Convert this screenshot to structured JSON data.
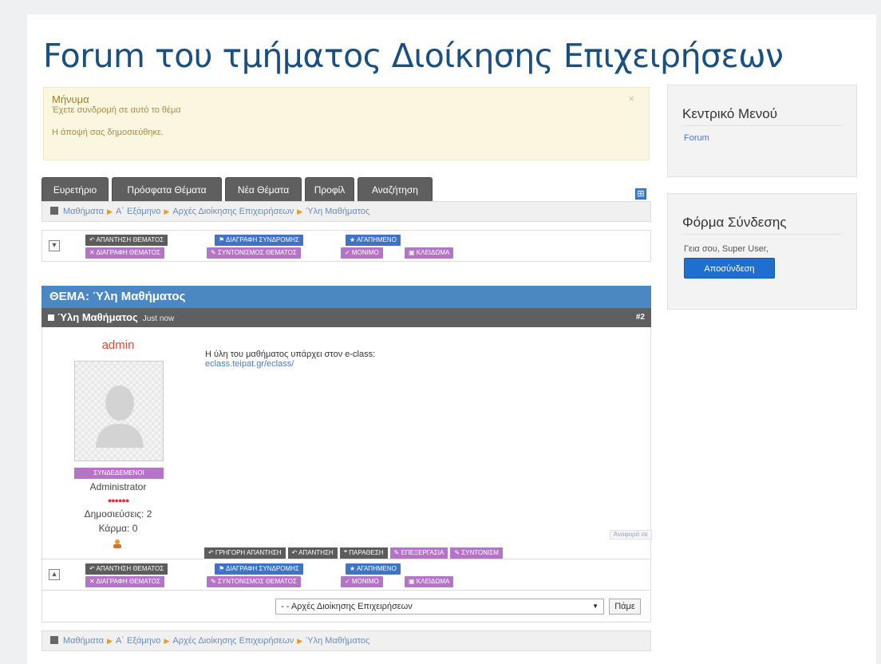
{
  "site": {
    "title": "Forum του τμήματος Διοίκησης Επιχειρήσεων"
  },
  "alert": {
    "heading": "Μήνυμα",
    "line1": "Έχετε συνδρομή σε αυτό το θέμα",
    "line2": "Η άποψή σας δημοσιεύθηκε.",
    "close": "×"
  },
  "tabs": [
    "Ευρετήριο",
    "Πρόσφατα Θέματα",
    "Νέα Θέματα",
    "Προφίλ",
    "Αναζήτηση"
  ],
  "breadcrumb": [
    "Μαθήματα",
    "Α΄ Εξάμηνο",
    "Αρχές Διοίκησης Επιχειρήσεων",
    "Ύλη Μαθήματος"
  ],
  "topic_actions": {
    "reply": "↶ ΑΠΑΝΤΗΣΗ ΘΕΜΑΤΟΣ",
    "unsubscribe": "⚑ ΔΙΑΓΡΑΦΗ ΣΥΝΔΡΟΜΗΣ",
    "favorite": "★ ΑΓΑΠΗΜΕΝΟ",
    "delete": "✕ ΔΙΑΓΡΑΦΗ ΘΕΜΑΤΟΣ",
    "moderate": "✎ ΣΥΝΤΟΝΙΣΜΟΣ ΘΕΜΑΤΟΣ",
    "sticky": "✓ ΜΟΝΙΜΟ",
    "lock": "▣ ΚΛΕΙΔΩΜΑ"
  },
  "topic": {
    "header": "ΘΕΜΑ: Ύλη Μαθήματος"
  },
  "post": {
    "title": "Ύλη Μαθήματος",
    "time": "Just now",
    "number": "#2",
    "author": "admin",
    "online_badge": "ΣΥΝΔΕΔΕΜΕΝΟΙ",
    "role": "Administrator",
    "rank_dots": "●●●●●●",
    "posts": "Δημοσιεύσεις: 2",
    "karma": "Κάρμα: 0",
    "text": "Η ύλη του μαθήματος υπάρχει στον e-class:",
    "link": "eclass.teipat.gr/eclass/",
    "report": "Αναφορά σε",
    "buttons": {
      "quick_reply": "↶ ΓΡΗΓΟΡΗ ΑΠΑΝΤΗΣΗ",
      "reply": "↶ ΑΠΑΝΤΗΣΗ",
      "quote": "❝ ΠΑΡΑΘΕΣΗ",
      "edit": "✎ ΕΠΕΞΕΡΓΑΣΙΑ",
      "moderate": "✎ ΣΥΝΤΟΝΙΣΜ"
    }
  },
  "jump": {
    "selected": "- - Αρχές Διοίκησης Επιχειρήσεων",
    "go": "Πάμε"
  },
  "toggles": {
    "collapse": "▾",
    "expand": "▴",
    "expand_all": "⊞"
  },
  "sidebar": {
    "menu_title": "Κεντρικό Μενού",
    "menu_link": "Forum",
    "login_title": "Φόρμα Σύνδεσης",
    "greeting": "Γεια σου, Super User,",
    "logout": "Αποσύνδεση"
  },
  "colors": {
    "title": "#1a4f82",
    "topic_header": "#4a87c3",
    "btn_gray": "#5c5c5c",
    "btn_blue": "#3f73c4",
    "btn_purple": "#b674c8",
    "logout": "#1e6fd0"
  }
}
